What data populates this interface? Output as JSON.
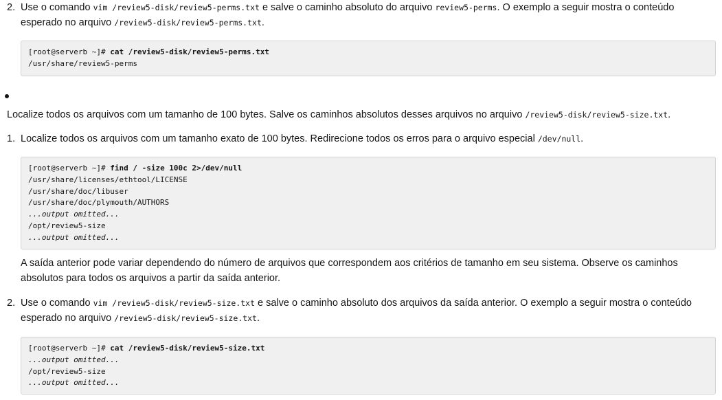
{
  "step2a": {
    "num": "2.",
    "t1": "Use o comando ",
    "c1": "vim /review5-disk/review5-perms.txt",
    "t2": " e salve o caminho absoluto do arquivo ",
    "c2": "review5-perms",
    "t3": ". O exemplo a seguir mostra o conteúdo",
    "t4": "esperado no arquivo ",
    "c3": "/review5-disk/review5-perms.txt",
    "t5": "."
  },
  "code1": {
    "prompt": "[root@serverb ~]# ",
    "cmd": "cat /review5-disk/review5-perms.txt",
    "out1": "/usr/share/review5-perms"
  },
  "intro": {
    "t1": "Localize todos os arquivos com um tamanho de 100 bytes. Salve os caminhos absolutos desses arquivos no arquivo ",
    "c1": "/review5-disk/review5-size.txt",
    "t2": "."
  },
  "step1": {
    "num": "1.",
    "t1": "Localize todos os arquivos com um tamanho exato de 100 bytes. Redirecione todos os erros para o arquivo especial ",
    "c1": "/dev/null",
    "t2": "."
  },
  "code2": {
    "prompt": "[root@serverb ~]# ",
    "cmd": "find / -size 100c 2>/dev/null",
    "out1": "/usr/share/licenses/ethtool/LICENSE",
    "out2": "/usr/share/doc/libuser",
    "out3": "/usr/share/doc/plymouth/AUTHORS",
    "out4": "...output omitted...",
    "out5": "/opt/review5-size",
    "out6": "...output omitted..."
  },
  "note": {
    "line1": "A saída anterior pode variar dependendo do número de arquivos que correspondem aos critérios de tamanho em seu sistema. Observe os caminhos",
    "line2": "absolutos para todos os arquivos a partir da saída anterior."
  },
  "step2b": {
    "num": "2.",
    "t1": "Use o comando ",
    "c1": "vim /review5-disk/review5-size.txt",
    "t2": " e salve o caminho absoluto dos arquivos da saída anterior. O exemplo a seguir mostra o conteúdo",
    "t3": "esperado no arquivo ",
    "c2": "/review5-disk/review5-size.txt",
    "t4": "."
  },
  "code3": {
    "prompt": "[root@serverb ~]# ",
    "cmd": "cat /review5-disk/review5-size.txt",
    "out1": "...output omitted...",
    "out2": "/opt/review5-size",
    "out3": "...output omitted..."
  }
}
